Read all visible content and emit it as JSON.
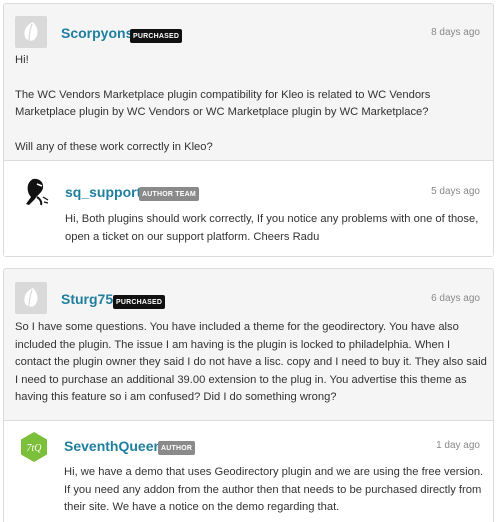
{
  "threads": [
    {
      "question": {
        "author": "Scorpyons",
        "badge": "PURCHASED",
        "time": "8 days ago",
        "paragraphs": [
          "Hi!",
          "The WC Vendors Marketplace plugin compatibility for Kleo is related to WC Vendors Marketplace plugin by WC Vendors or WC Marketplace plugin by WC Marketplace?",
          "Will any of these work correctly in Kleo?"
        ]
      },
      "reply": {
        "author": "sq_support",
        "badge": "AUTHOR TEAM",
        "time": "5 days ago",
        "text": "Hi, Both plugins should work correctly, If you notice any problems with one of those, open a ticket on our support platform. Cheers Radu"
      }
    },
    {
      "question": {
        "author": "Sturg75",
        "badge": "PURCHASED",
        "time": "6 days ago",
        "text": "So I have some questions. You have included a theme for the geodirectory. You have also included the plugin. The issue I am having is the plugin is locked to philadelphia. When I contact the plugin owner they said I do not have a lisc. copy and I need to buy it. They also said I need to purchase an additional 39.00 extension to the plug in. You advertise this theme as having this feature so i am confused? Did I do something wrong?"
      },
      "reply": {
        "author": "SeventhQueen",
        "badge": "AUTHOR",
        "time": "1 day ago",
        "text": "Hi, we have a demo that uses Geodirectory plugin and we are using the free version. If you need any addon from the author then that needs to be purchased directly from their site. We have a notice on the demo regarding that.",
        "avatar_text": "7tQ"
      }
    }
  ],
  "colors": {
    "author_link": "#1f7f9f",
    "purchased_badge": "#111111",
    "author_badge": "#8a8a8a",
    "seventhqueen_avatar": "#7bbf3a"
  }
}
